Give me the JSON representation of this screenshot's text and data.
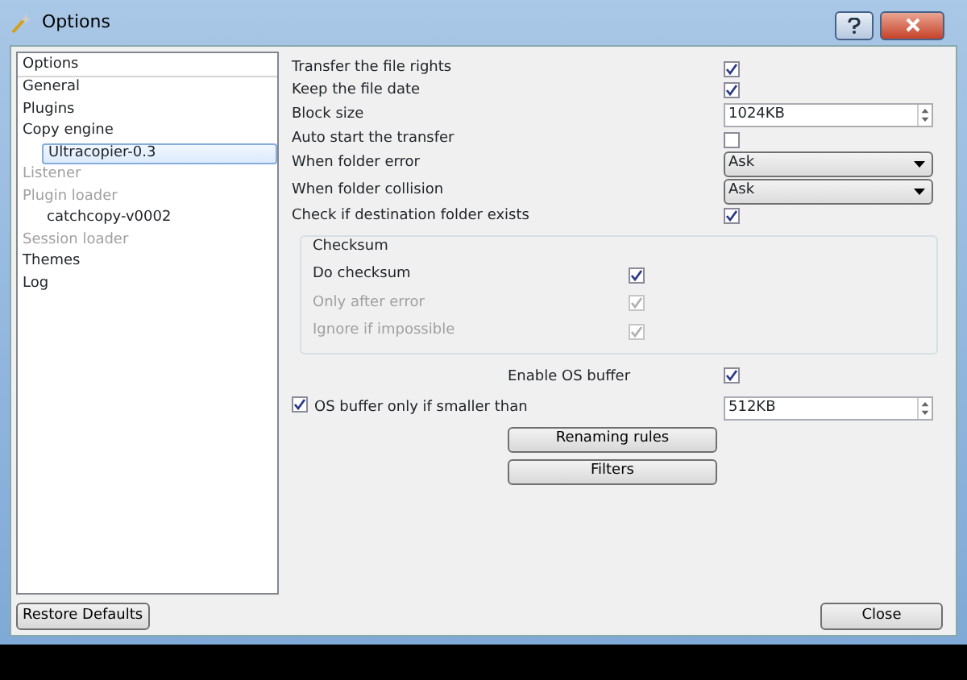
{
  "window": {
    "title": "Options"
  },
  "tree": {
    "header": "Options",
    "items": [
      {
        "label": "General",
        "disabled": false,
        "selected": false
      },
      {
        "label": "Plugins",
        "disabled": false,
        "selected": false
      },
      {
        "label": "Copy engine",
        "disabled": false,
        "selected": false,
        "children": [
          {
            "label": "Ultracopier-0.3",
            "disabled": false,
            "selected": true
          }
        ]
      },
      {
        "label": "Listener",
        "disabled": true,
        "selected": false
      },
      {
        "label": "Plugin loader",
        "disabled": true,
        "selected": false,
        "children": [
          {
            "label": "catchcopy-v0002",
            "disabled": false,
            "selected": false
          }
        ]
      },
      {
        "label": "Session loader",
        "disabled": true,
        "selected": false
      },
      {
        "label": "Themes",
        "disabled": false,
        "selected": false
      },
      {
        "label": "Log",
        "disabled": false,
        "selected": false
      }
    ]
  },
  "settings": [
    {
      "label": "Transfer the file rights",
      "kind": "checkbox",
      "checked": true
    },
    {
      "label": "Keep the file date",
      "kind": "checkbox",
      "checked": true
    },
    {
      "label": "Block size",
      "kind": "spin",
      "value": "1024KB"
    },
    {
      "label": "Auto start the transfer",
      "kind": "checkbox",
      "checked": false
    },
    {
      "label": "When folder error",
      "kind": "select",
      "value": "Ask"
    },
    {
      "label": "When folder collision",
      "kind": "select",
      "value": "Ask"
    },
    {
      "label": "Check if destination folder exists",
      "kind": "checkbox",
      "checked": true
    }
  ],
  "checksum": {
    "title": "Checksum",
    "rows": [
      {
        "label": "Do checksum",
        "checked": true,
        "disabled": false
      },
      {
        "label": "Only after error",
        "checked": true,
        "disabled": true
      },
      {
        "label": "Ignore if impossible",
        "checked": true,
        "disabled": true
      }
    ]
  },
  "os_buffer": {
    "label": "Enable OS buffer",
    "checked": true
  },
  "os_buffer_limit": {
    "label": "OS buffer only if smaller than",
    "checked": true,
    "value": "512KB"
  },
  "buttons": [
    "Renaming rules",
    "Filters"
  ],
  "restore_button": "Restore Defaults",
  "close_button": "Close"
}
